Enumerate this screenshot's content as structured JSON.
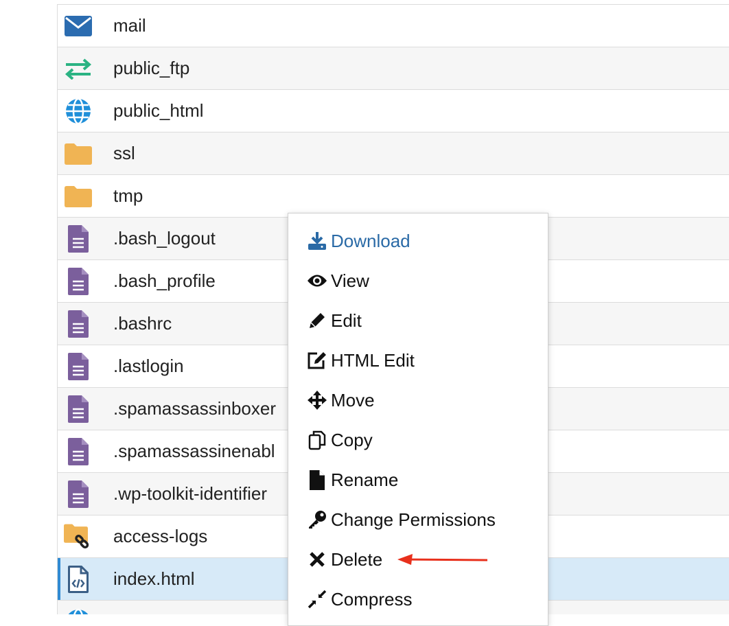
{
  "files": [
    {
      "name": "mail",
      "icon": "envelope-icon",
      "type": "mail"
    },
    {
      "name": "public_ftp",
      "icon": "transfer-arrows-icon",
      "type": "ftp"
    },
    {
      "name": "public_html",
      "icon": "globe-icon",
      "type": "web"
    },
    {
      "name": "ssl",
      "icon": "folder-icon",
      "type": "folder"
    },
    {
      "name": "tmp",
      "icon": "folder-icon",
      "type": "folder"
    },
    {
      "name": ".bash_logout",
      "icon": "file-text-icon",
      "type": "file"
    },
    {
      "name": ".bash_profile",
      "icon": "file-text-icon",
      "type": "file"
    },
    {
      "name": ".bashrc",
      "icon": "file-text-icon",
      "type": "file"
    },
    {
      "name": ".lastlogin",
      "icon": "file-text-icon",
      "type": "file"
    },
    {
      "name": ".spamassassinboxer",
      "icon": "file-text-icon",
      "type": "file"
    },
    {
      "name": ".spamassassinenabl",
      "icon": "file-text-icon",
      "type": "file"
    },
    {
      "name": ".wp-toolkit-identifier",
      "icon": "file-text-icon",
      "type": "file"
    },
    {
      "name": "access-logs",
      "icon": "folder-link-icon",
      "type": "folder-link"
    },
    {
      "name": "index.html",
      "icon": "file-code-icon",
      "type": "html",
      "selected": true
    },
    {
      "name": "",
      "icon": "globe-icon",
      "type": "web"
    }
  ],
  "context_menu": {
    "items": [
      {
        "label": "Download",
        "icon": "download-icon"
      },
      {
        "label": "View",
        "icon": "eye-icon"
      },
      {
        "label": "Edit",
        "icon": "pencil-icon"
      },
      {
        "label": "HTML Edit",
        "icon": "edit-square-icon"
      },
      {
        "label": "Move",
        "icon": "move-arrows-icon"
      },
      {
        "label": "Copy",
        "icon": "copy-icon"
      },
      {
        "label": "Rename",
        "icon": "file-icon"
      },
      {
        "label": "Change Permissions",
        "icon": "key-icon"
      },
      {
        "label": "Delete",
        "icon": "close-icon"
      },
      {
        "label": "Compress",
        "icon": "compress-icon"
      }
    ]
  },
  "colors": {
    "folder": "#f0b454",
    "file": "#7b5f9c",
    "mail": "#2b6cb0",
    "ftp": "#2bb383",
    "globe": "#1f8fd9",
    "selected_row": "#d7eaf8",
    "link_blue": "#2a6aa6",
    "annotation": "#e8301c"
  }
}
